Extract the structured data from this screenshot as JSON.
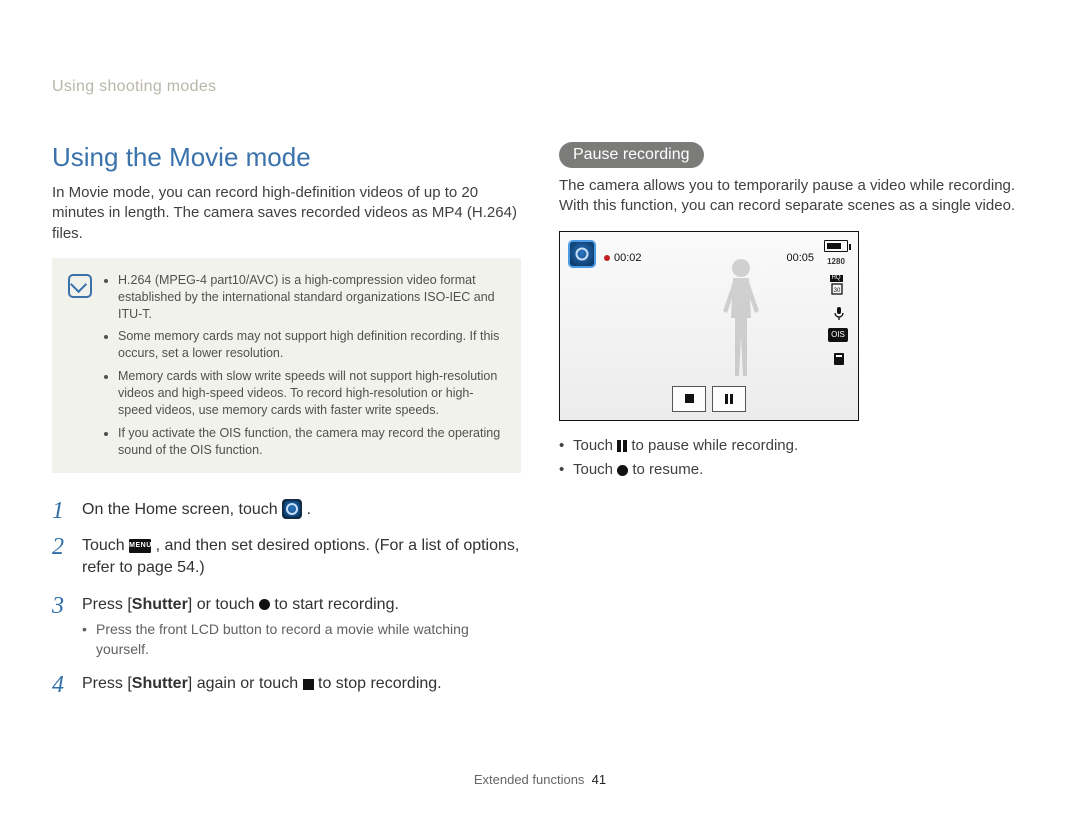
{
  "breadcrumb": "Using shooting modes",
  "heading": "Using the Movie mode",
  "intro": "In Movie mode, you can record high-definition videos of up to 20 minutes in length. The camera saves recorded videos as MP4 (H.264) files.",
  "notes": {
    "items": [
      "H.264 (MPEG-4 part10/AVC) is a high-compression video format established by the international standard organizations ISO-IEC and ITU-T.",
      "Some memory cards may not support high definition recording. If this occurs, set a lower resolution.",
      "Memory cards with slow write speeds will not support high-resolution videos and high-speed videos. To record high-resolution or high-speed videos, use memory cards with faster write speeds.",
      "If you activate the OIS function, the camera may record the operating sound of the OIS function."
    ]
  },
  "steps": {
    "s1_a": "On the Home screen, touch ",
    "s1_b": ".",
    "s2_a": "Touch ",
    "s2_menu": "MENU",
    "s2_b": ", and then set desired options. (For a list of options, refer to page 54.)",
    "s3_a": "Press [",
    "s3_b": "Shutter",
    "s3_c": "] or touch ",
    "s3_d": " to start recording.",
    "s3_sub": "Press the front LCD button to record a movie while watching yourself.",
    "s4_a": "Press [",
    "s4_b": "Shutter",
    "s4_c": "] again or touch ",
    "s4_d": " to stop recording."
  },
  "right": {
    "pill": "Pause recording",
    "para": "The camera allows you to temporarily pause a video while recording. With this function, you can record separate scenes as a single video.",
    "screen": {
      "elapsed": "00:02",
      "total": "00:05",
      "res_top": "1280",
      "res_bot": "HQ",
      "fps": "30",
      "ois": "OIS"
    },
    "tips": {
      "t1_a": "Touch ",
      "t1_b": " to pause while recording.",
      "t2_a": "Touch ",
      "t2_b": " to resume."
    }
  },
  "footer": {
    "section": "Extended functions",
    "page": "41"
  }
}
